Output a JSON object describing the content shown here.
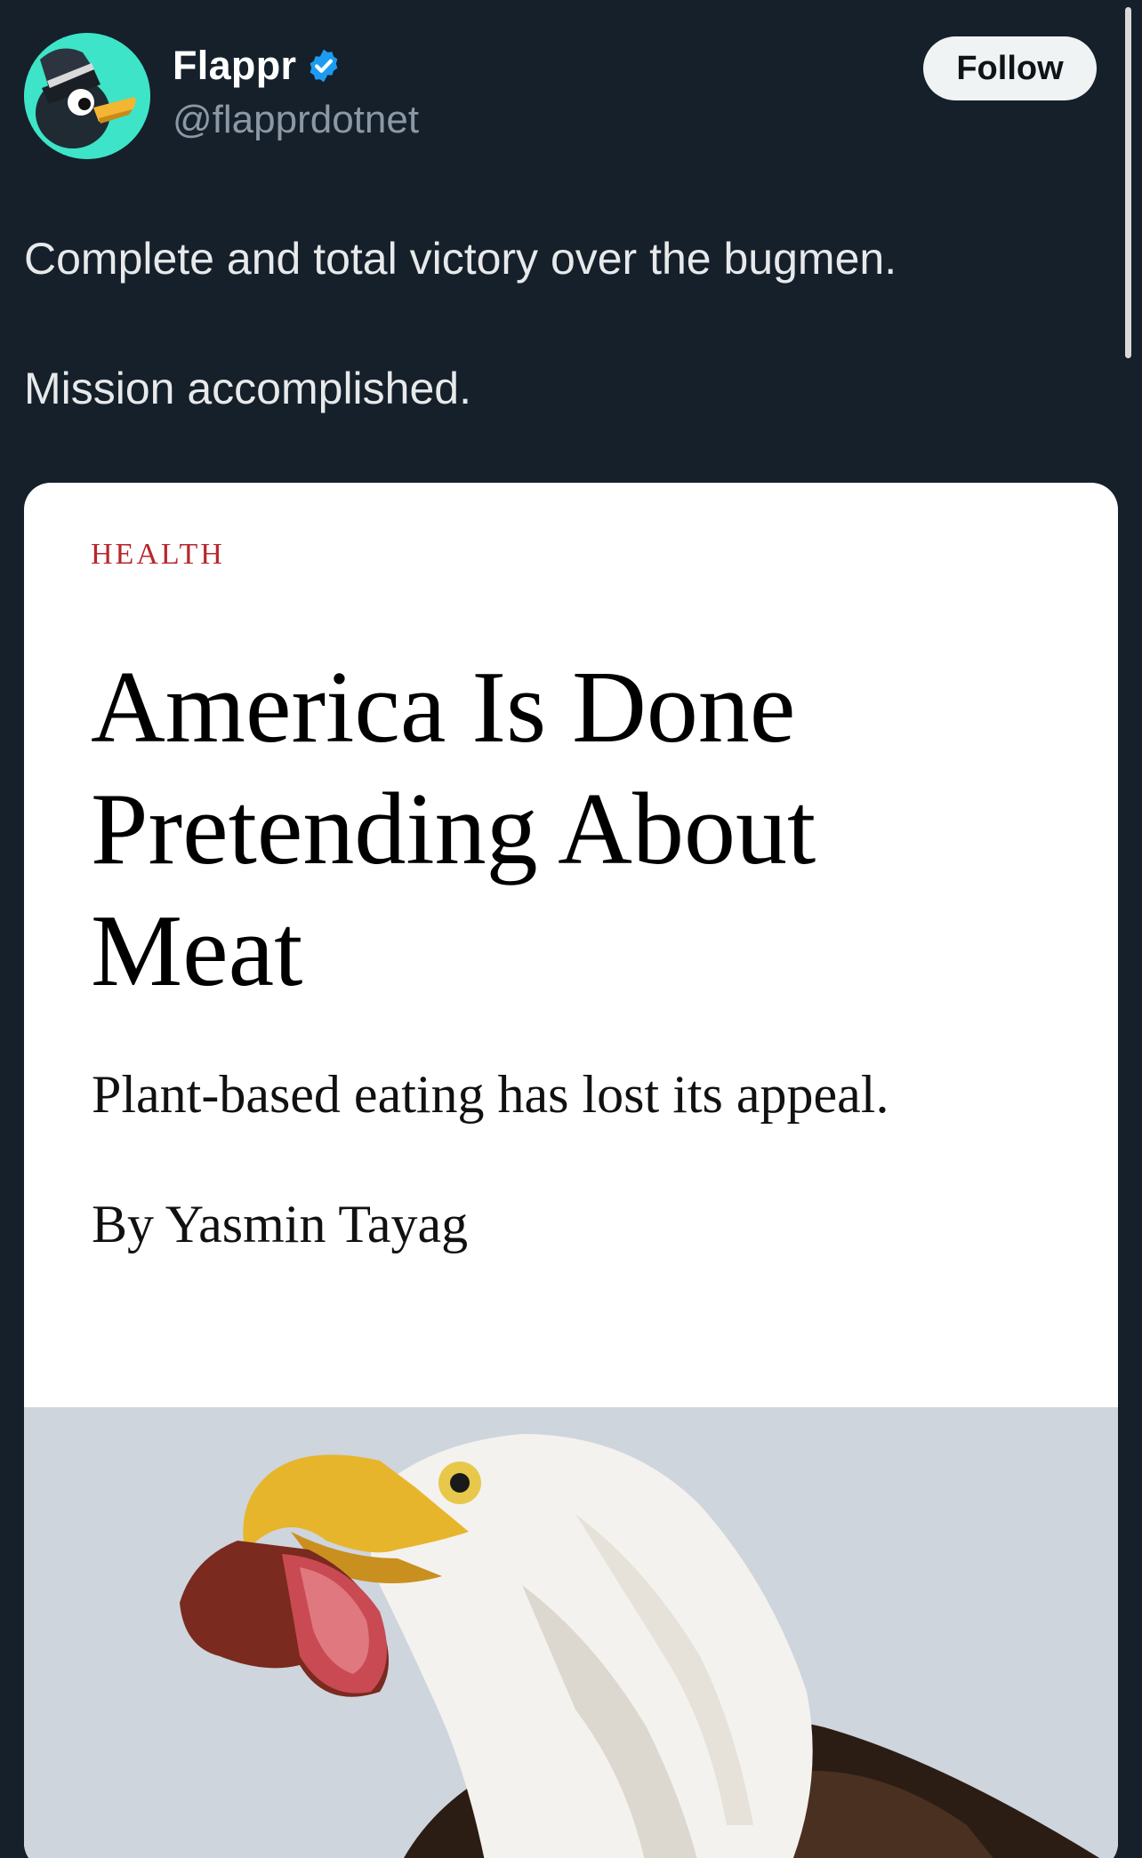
{
  "account": {
    "display_name": "Flappr",
    "handle": "@flapprdotnet",
    "verified": true,
    "verified_color": "#1d9bf0",
    "avatar_bg": "#3ee4c7"
  },
  "actions": {
    "follow_label": "Follow"
  },
  "tweet": {
    "line1": "Complete and total victory over the bugmen.",
    "line2": "Mission accomplished."
  },
  "card": {
    "section": "HEALTH",
    "section_color": "#b8272c",
    "headline_line1": "America Is Done",
    "headline_line2": "Pretending About",
    "headline_line3": "Meat",
    "dek": "Plant-based eating has lost its appeal.",
    "byline": "By Yasmin Tayag",
    "image_subject": "bald-eagle-eating-meat"
  },
  "colors": {
    "background": "#15202b",
    "text_primary": "#e7e9ea",
    "text_secondary": "#8b98a5"
  }
}
